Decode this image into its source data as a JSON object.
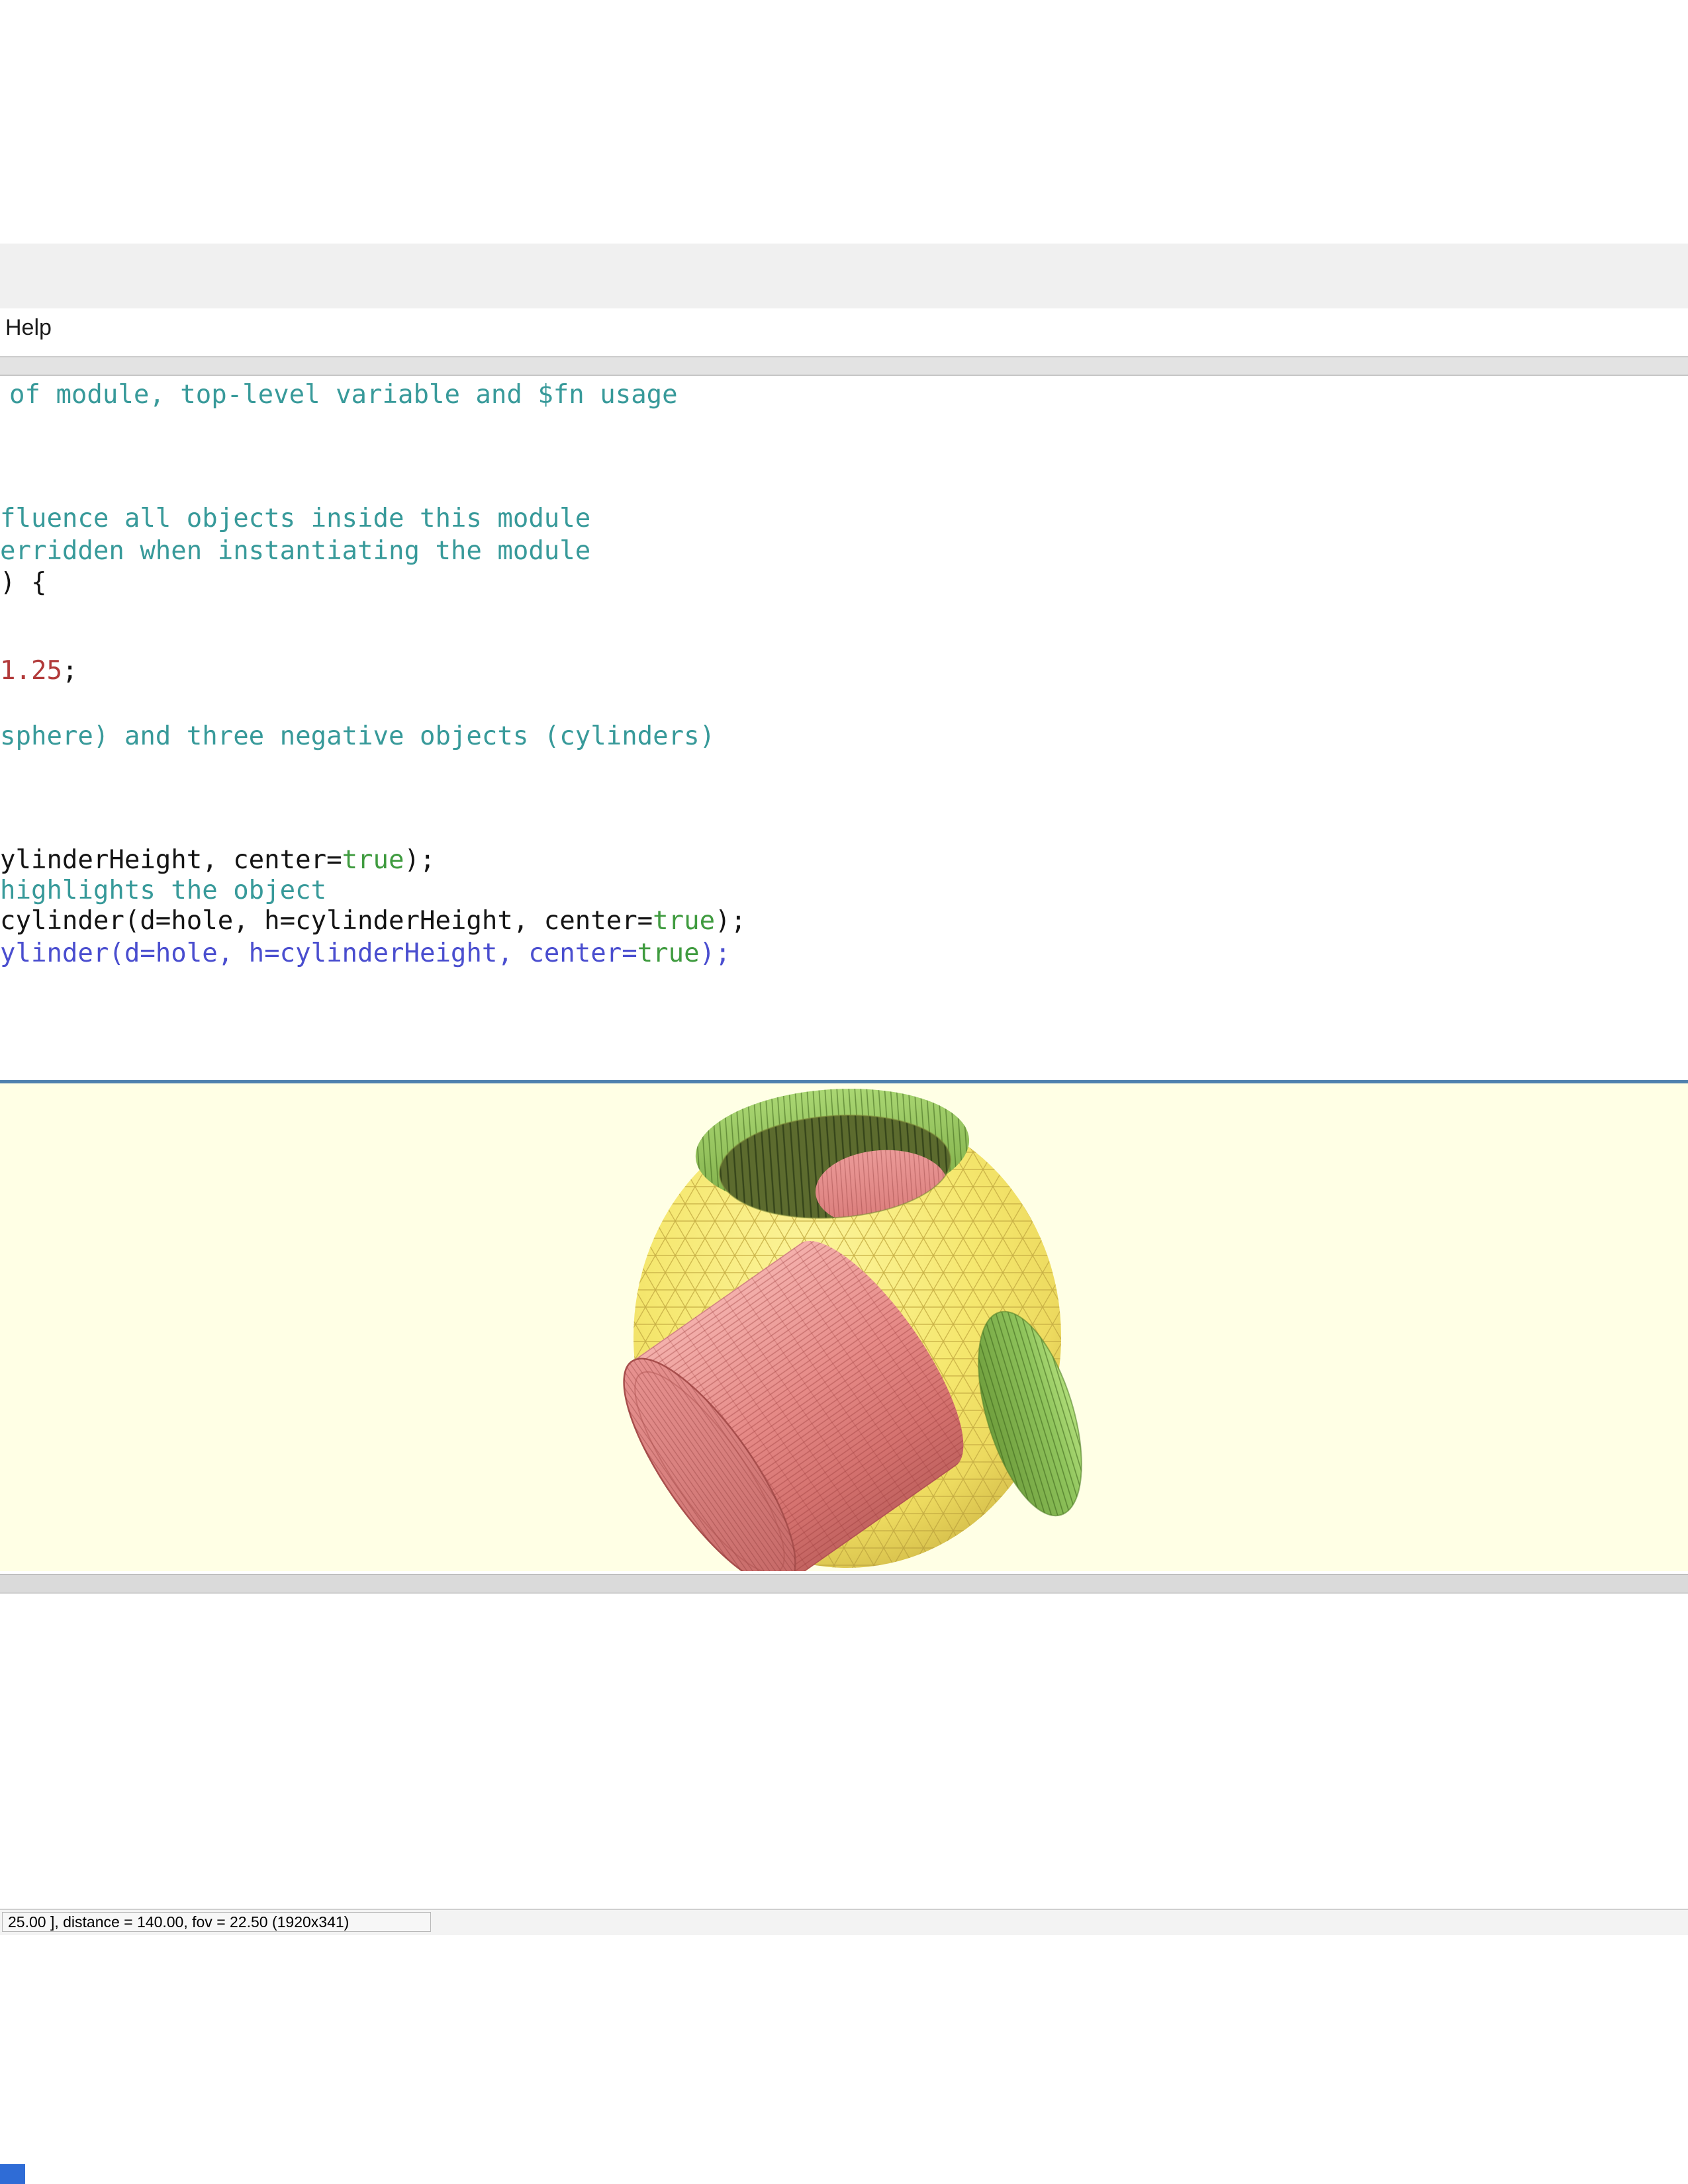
{
  "menubar": {
    "items": [
      {
        "label": "Help"
      }
    ]
  },
  "editor": {
    "lines": [
      {
        "x": 14,
        "segments": [
          {
            "text": "of module, top-level variable and $fn usage",
            "style": "comment"
          }
        ]
      },
      {
        "x": 0,
        "segments": [
          {
            "text": "fluence all objects inside this module",
            "style": "comment"
          }
        ]
      },
      {
        "x": 0,
        "segments": [
          {
            "text": "erridden when instantiating the module",
            "style": "comment"
          }
        ]
      },
      {
        "x": 0,
        "segments": [
          {
            "text": ") {",
            "style": "plain"
          }
        ]
      },
      {
        "x": 0,
        "segments": [
          {
            "text": "1.25",
            "style": "number"
          },
          {
            "text": ";",
            "style": "plain"
          }
        ]
      },
      {
        "x": 0,
        "segments": [
          {
            "text": "sphere) and three negative objects (cylinders)",
            "style": "comment"
          }
        ]
      },
      {
        "x": 0,
        "segments": [
          {
            "text": "ylinderHeight, center=",
            "style": "plain"
          },
          {
            "text": "true",
            "style": "keyword"
          },
          {
            "text": ");",
            "style": "plain"
          }
        ]
      },
      {
        "x": 0,
        "segments": [
          {
            "text": "highlights the object",
            "style": "comment"
          }
        ]
      },
      {
        "x": 0,
        "segments": [
          {
            "text": "cylinder(d=hole, h=cylinderHeight, center=",
            "style": "plain"
          },
          {
            "text": "true",
            "style": "keyword"
          },
          {
            "text": ");",
            "style": "plain"
          }
        ]
      },
      {
        "x": 0,
        "segments": [
          {
            "text": "ylinder(d=hole, h=cylinderHeight, center=",
            "style": "blue"
          },
          {
            "text": "true",
            "style": "keyword"
          },
          {
            "text": ");",
            "style": "blue"
          }
        ]
      }
    ]
  },
  "viewport": {
    "background_color": "#FFFFE5",
    "model": "csg-sphere-with-cylinder-holes",
    "colors": {
      "sphere_yellow": "#F4E56A",
      "mesh_line": "#C4AB42",
      "highlight_red": "#E08585",
      "highlight_green": "#8FBF55",
      "hole_interior_green": "#5C6B2E"
    }
  },
  "statusbar": {
    "camera_text": "25.00 ], distance = 140.00, fov = 22.50 (1920x341)"
  }
}
